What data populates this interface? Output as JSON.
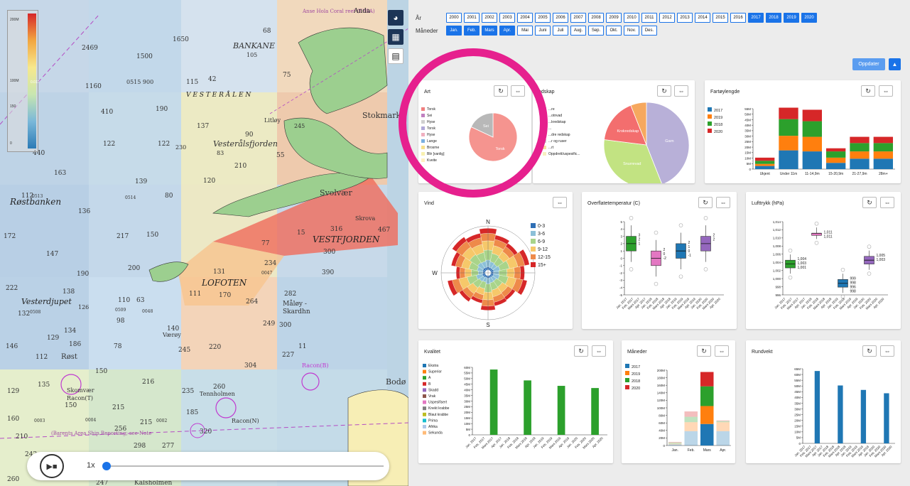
{
  "map": {
    "labels": {
      "l_2469": "2469",
      "l_1500": "1500",
      "l_1650": "1650",
      "l_68": "68",
      "l_bankane": "BANKANE",
      "l_105": "105",
      "l_75": "75",
      "l_1160": "1160",
      "l_900": "0515 900",
      "l_115": "115",
      "l_42": "42",
      "l_vesteralen": "V E S T E R Å L E N",
      "l_410": "410",
      "l_190": "190",
      "l_137": "137",
      "l_littoy": "Litløy",
      "l_90": "90",
      "l_122a": "122",
      "l_122b": "122",
      "l_230": "230",
      "l_vfjorden": "Vesterålsfjorden",
      "l_83": "83",
      "l_245": "245",
      "l_stokmark": "Stokmark",
      "l_440": "440",
      "l_210": "210",
      "l_55": "55",
      "l_163": "163",
      "l_139": "139",
      "l_120": "120",
      "l_112": "112",
      "l_0513": "0513",
      "l_rostbanken": "Røstbanken",
      "l_136": "136",
      "l_0514": "0514",
      "l_80": "80",
      "l_svolvaer": "Svolvær",
      "l_skrova": "Skrova",
      "l_316": "316",
      "l_467": "467",
      "l_172": "172",
      "l_217": "217",
      "l_150a": "150",
      "l_77": "77",
      "l_15": "15",
      "l_vestfjorden": "VESTFJORDEN",
      "l_300": "300",
      "l_147": "147",
      "l_200": "200",
      "l_131": "131",
      "l_234": "234",
      "l_0047": "0047",
      "l_390": "390",
      "l_190b": "190",
      "l_lofoten": "LOFOTEN",
      "l_222": "222",
      "l_138": "138",
      "l_vesterdjupet": "Vesterdjupet",
      "l_126": "126",
      "l_110": "110",
      "l_63": "63",
      "l_111": "111",
      "l_170": "170",
      "l_264": "264",
      "l_282": "282",
      "l_maloy": "Måløy -",
      "l_skardhn": "Skardhn",
      "l_132": "132",
      "l_0508": "0508",
      "l_0509": "0509",
      "l_0048": "0048",
      "l_67": "67",
      "l_98": "98",
      "l_140": "140",
      "l_vaeroy": "Værøy",
      "l_249": "249",
      "l_300b": "300",
      "l_134": "134",
      "l_129": "129",
      "l_186": "186",
      "l_146": "146",
      "l_112b": "112",
      "l_rost": "Røst",
      "l_78": "78",
      "l_245b": "245",
      "l_220": "220",
      "l_227": "227",
      "l_11": "11",
      "l_304": "304",
      "l_135": "135",
      "l_150b": "150",
      "l_216": "216",
      "l_skomvaer": "Skomvær",
      "l_racont": "Racon(T)",
      "l_racon_b": "Racon(B)",
      "l_235": "235",
      "l_260": "260",
      "l_tennholmen": "Tennholmen",
      "l_129b": "129",
      "l_150c": "150",
      "l_215": "215",
      "l_185": "185",
      "l_215b": "215",
      "l_racon_n": "Racon(N)",
      "l_bodo": "Bodø",
      "l_160": "160",
      "l_0003": "0003",
      "l_0004": "0004",
      "l_0002": "0002",
      "l_256": "256",
      "l_210b": "210",
      "l_barents": "(Barents Area Ship Reporting; see Note",
      "l_320": "320",
      "l_242": "242",
      "l_298": "298",
      "l_277": "277",
      "l_247": "247",
      "l_kalsholmen": "Kalsholmen",
      "l_260b": "260",
      "l_coral": "Anse Hola Coral reef (ESSA)",
      "l_anda": "Anda"
    },
    "legend": {
      "top": "200M",
      "mid": "100M",
      "low": "150",
      "bottom": "0",
      "side": "0.017"
    },
    "player": {
      "speed": "1x",
      "progress": 0.0
    }
  },
  "filters": {
    "year_label": "År",
    "years": [
      {
        "label": "2000",
        "selected": false
      },
      {
        "label": "2001",
        "selected": false
      },
      {
        "label": "2002",
        "selected": false
      },
      {
        "label": "2003",
        "selected": false
      },
      {
        "label": "2004",
        "selected": false
      },
      {
        "label": "2005",
        "selected": false
      },
      {
        "label": "2006",
        "selected": false
      },
      {
        "label": "2007",
        "selected": false
      },
      {
        "label": "2008",
        "selected": false
      },
      {
        "label": "2009",
        "selected": false
      },
      {
        "label": "2010",
        "selected": false
      },
      {
        "label": "2011",
        "selected": false
      },
      {
        "label": "2012",
        "selected": false
      },
      {
        "label": "2013",
        "selected": false
      },
      {
        "label": "2014",
        "selected": false
      },
      {
        "label": "2015",
        "selected": false
      },
      {
        "label": "2016",
        "selected": false
      },
      {
        "label": "2017",
        "selected": true
      },
      {
        "label": "2018",
        "selected": true
      },
      {
        "label": "2019",
        "selected": true
      },
      {
        "label": "2020",
        "selected": true
      }
    ],
    "month_label": "Måneder",
    "months": [
      {
        "label": "Jan.",
        "selected": true
      },
      {
        "label": "Feb.",
        "selected": true
      },
      {
        "label": "Mars",
        "selected": true
      },
      {
        "label": "Apr.",
        "selected": true
      },
      {
        "label": "Mai",
        "selected": false
      },
      {
        "label": "Juni",
        "selected": false
      },
      {
        "label": "Juli",
        "selected": false
      },
      {
        "label": "Aug.",
        "selected": false
      },
      {
        "label": "Sep.",
        "selected": false
      },
      {
        "label": "Okt.",
        "selected": false
      },
      {
        "label": "Nov.",
        "selected": false
      },
      {
        "label": "Des.",
        "selected": false
      }
    ],
    "update_label": "Oppdater"
  },
  "cards": {
    "art": "Art",
    "redskap": "edskap",
    "fartoy": "Fartøylengde",
    "vind": "Vind",
    "temp": "Overflatetemperatur (C)",
    "trykk": "Lufttrykk (hPa)",
    "kvalitet": "Kvalitet",
    "maneder": "Måneder",
    "rundvekt": "Rundvekt"
  },
  "chart_data": [
    {
      "id": "art",
      "type": "pie",
      "legend": [
        "Torsk",
        "Sei",
        "Hyse",
        "Torsk",
        "Hyse",
        "Lange",
        "Brosme",
        "Blir [vanlig]",
        "Kveite"
      ],
      "legend_colors": [
        "#f08080",
        "#c080c0",
        "#d0d0d0",
        "#b0a8d8",
        "#f0b0c0",
        "#7ab0e0",
        "#f7e08c",
        "#f8f0b0",
        "#fff0c0"
      ],
      "slices": [
        {
          "label": "Torsk",
          "value": 82,
          "color": "#f5948f"
        },
        {
          "label": "Sei",
          "value": 18,
          "color": "#b8b8b8"
        }
      ]
    },
    {
      "id": "redskap",
      "type": "pie",
      "legend": [
        "...re",
        "...otnvad",
        "...kredskap",
        "...",
        "...dre redskap",
        "...r og ruser",
        "...rt",
        "Oppdrett/uspesific..."
      ],
      "legend_colors": [
        "#b0a8d8",
        "#c0e088",
        "#f0a060",
        "#f07070",
        "#f0c0d0",
        "#d0d0d0",
        "#f8e0a0",
        "#f8f0c0"
      ],
      "slices": [
        {
          "label": "Garn",
          "value": 44,
          "color": "#b8b0d8"
        },
        {
          "label": "Snurrevad",
          "value": 33,
          "color": "#c2e382"
        },
        {
          "label": "Krokredskap",
          "value": 17,
          "color": "#f36e6e"
        },
        {
          "label": "",
          "value": 6,
          "color": "#f6a85e"
        }
      ]
    },
    {
      "id": "fartoy",
      "type": "bar",
      "categories": [
        "Ukjent",
        "Under 11m",
        "11-14,9m",
        "15-20,9m",
        "21-27,9m",
        "28m+"
      ],
      "series": [
        {
          "name": "2017",
          "color": "#1f77b4",
          "values": [
            3,
            18,
            17,
            6,
            10,
            10
          ]
        },
        {
          "name": "2019",
          "color": "#ff7f0e",
          "values": [
            2,
            14,
            14,
            5,
            7,
            7
          ]
        },
        {
          "name": "2018",
          "color": "#2ca02c",
          "values": [
            3,
            16,
            15,
            6,
            8,
            8
          ]
        },
        {
          "name": "2020",
          "color": "#d62728",
          "values": [
            3,
            11,
            11,
            3,
            6,
            6
          ]
        }
      ],
      "yticks": [
        "0",
        "5M",
        "10M",
        "15M",
        "20M",
        "25M",
        "30M",
        "35M",
        "40M",
        "45M",
        "50M",
        "55M"
      ],
      "ylim": [
        0,
        58
      ]
    },
    {
      "id": "vind",
      "type": "polar-bar",
      "directions": [
        "N",
        "W",
        "S"
      ],
      "legend": [
        "0-3",
        "3-6",
        "6-9",
        "9-12",
        "12-15",
        "15+"
      ],
      "legend_colors": [
        "#2f6fb5",
        "#8cc0d8",
        "#a9d48a",
        "#f6c86a",
        "#ee8a4a",
        "#d62728"
      ]
    },
    {
      "id": "temp",
      "type": "boxplot",
      "categories": [
        "Jan. 2017",
        "Feb. 2017",
        "Mars 2017",
        "Apr. 2017",
        "Jan. 2018",
        "Feb. 2018",
        "Mars 2018",
        "Apr. 2018",
        "Jan. 2019",
        "Feb. 2019",
        "Mars 2019",
        "Apr. 2019",
        "Jan. 2020",
        "Feb. 2020",
        "Mars 2020",
        "Apr. 2020"
      ],
      "boxes": [
        {
          "color": "#2ca02c",
          "median": 2,
          "q1": 1,
          "q3": 3,
          "labels": [
            "3",
            "2",
            "1"
          ]
        },
        {
          "color": "#e377c2",
          "median": 0,
          "q1": -1,
          "q3": 1,
          "labels": [
            "2",
            "0",
            "-2"
          ]
        },
        {
          "color": "#1f77b4",
          "median": 1,
          "q1": 0,
          "q3": 2,
          "labels": [
            "2",
            "1",
            "0",
            "-1"
          ]
        },
        {
          "color": "#9467bd",
          "median": 2,
          "q1": 1,
          "q3": 3,
          "labels": [
            "2",
            "2"
          ]
        }
      ],
      "yticks": [
        "-5",
        "-4",
        "-3",
        "-2",
        "-1",
        "0",
        "1",
        "2",
        "3",
        "4",
        "5"
      ],
      "ylim": [
        -5,
        5
      ]
    },
    {
      "id": "trykk",
      "type": "boxplot",
      "boxes": [
        {
          "color": "#2ca02c",
          "median": 1003,
          "q1": 1002,
          "q3": 1004,
          "labels": [
            "1,004",
            "1,003",
            "1,001"
          ]
        },
        {
          "color": "#e377c2",
          "median": 1011,
          "q1": 1011,
          "q3": 1011,
          "labels": [
            "1,011",
            "1,011"
          ]
        },
        {
          "color": "#1f77b4",
          "median": 998,
          "q1": 997,
          "q3": 999,
          "labels": [
            "999",
            "998",
            "996",
            "998"
          ]
        },
        {
          "color": "#9467bd",
          "median": 1004,
          "q1": 1003,
          "q3": 1005,
          "labels": [
            "1,005",
            "1,003"
          ]
        }
      ],
      "yticks": [
        "996",
        "998",
        "1,000",
        "1,002",
        "1,004",
        "1,006",
        "1,008",
        "1,010",
        "1,012",
        "1,014"
      ],
      "ylim": [
        995,
        1014
      ]
    },
    {
      "id": "kvalitet",
      "type": "bar",
      "legend": [
        "Ekstra",
        "Superior",
        "A",
        "B",
        "Skadd",
        "Vrak",
        "Uspesifisert",
        "Knekt krabbe",
        "Blaut krabbe",
        "Prima",
        "Afrika",
        "Sekunda"
      ],
      "legend_colors": [
        "#1f77b4",
        "#ff7f0e",
        "#2ca02c",
        "#d62728",
        "#9467bd",
        "#8c564b",
        "#e377c2",
        "#7f7f7f",
        "#bcbd22",
        "#17becf",
        "#aec7e8",
        "#ffbb78"
      ],
      "categories": [
        "Jan. 2017",
        "Feb. 2017",
        "Mars 2017",
        "Apr. 2017",
        "Jan. 2018",
        "Feb. 2018",
        "Mars 2018",
        "Apr. 2018",
        "Jan. 2019",
        "Feb. 2019",
        "Mars 2019",
        "Apr. 2019",
        "Jan. 2020",
        "Feb. 2020",
        "Mars 2020",
        "Apr. 2020"
      ],
      "values": [
        0,
        0,
        60,
        0,
        0,
        0,
        50,
        0,
        0,
        0,
        45,
        0,
        0,
        0,
        43,
        0
      ],
      "yticks": [
        "0",
        "5M",
        "10M",
        "15M",
        "20M",
        "25M",
        "30M",
        "35M",
        "40M",
        "45M",
        "50M",
        "55M",
        "60M"
      ],
      "ylim": [
        0,
        62
      ]
    },
    {
      "id": "maneder",
      "type": "bar",
      "categories": [
        "Jan.",
        "Feb.",
        "Mars",
        "Apr."
      ],
      "series": [
        {
          "name": "2017",
          "color": "#1f77b4",
          "values": [
            3,
            40,
            60,
            40
          ]
        },
        {
          "name": "2019",
          "color": "#ff7f0e",
          "values": [
            2,
            25,
            50,
            25
          ]
        },
        {
          "name": "2018",
          "color": "#2ca02c",
          "values": [
            3,
            15,
            55,
            3
          ]
        },
        {
          "name": "2020",
          "color": "#d62728",
          "values": [
            2,
            15,
            40,
            2
          ]
        }
      ],
      "faded": [
        true,
        true,
        false,
        true
      ],
      "yticks": [
        "0",
        "20M",
        "40M",
        "60M",
        "80M",
        "100M",
        "120M",
        "140M",
        "160M",
        "180M",
        "200M"
      ],
      "ylim": [
        0,
        210
      ]
    },
    {
      "id": "rundvekt",
      "type": "bar",
      "values": [
        0,
        0,
        65,
        0,
        0,
        0,
        52,
        0,
        0,
        0,
        48,
        0,
        0,
        0,
        45,
        0
      ],
      "yticks": [
        "0",
        "5M",
        "10M",
        "15M",
        "20M",
        "25M",
        "30M",
        "35M",
        "40M",
        "45M",
        "50M",
        "55M",
        "60M",
        "65M"
      ],
      "ylim": [
        0,
        67
      ]
    }
  ]
}
